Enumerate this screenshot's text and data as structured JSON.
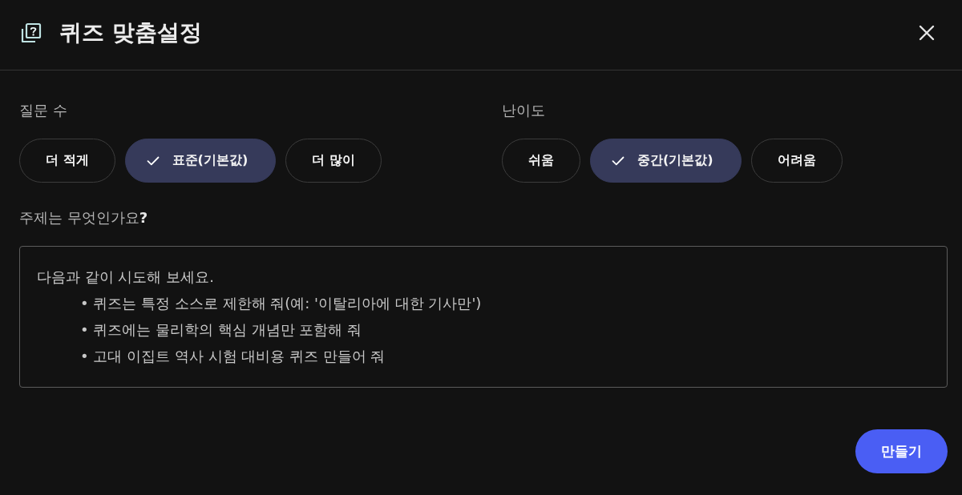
{
  "dialog": {
    "title": "퀴즈 맞춤설정"
  },
  "settings": [
    {
      "label": "질문 수",
      "options": [
        {
          "label": "더 적게",
          "selected": false
        },
        {
          "label": "표준(기본값)",
          "selected": true
        },
        {
          "label": "더 많이",
          "selected": false
        }
      ]
    },
    {
      "label": "난이도",
      "options": [
        {
          "label": "쉬움",
          "selected": false
        },
        {
          "label": "중간(기본값)",
          "selected": true
        },
        {
          "label": "어려움",
          "selected": false
        }
      ]
    }
  ],
  "topic": {
    "label": "주제는 무엇인가요**?**",
    "placeholder": "다음과 같이 시도해 보세요.",
    "examples": [
      "• 퀴즈는 특정 소스로 제한해 줘(예: '이탈리아에 대한 기사만')",
      "• 퀴즈에는 물리학의 핵심 개념만 포함해 줘",
      "• 고대 이집트 역사 시험 대비용 퀴즈 만들어 줘"
    ]
  },
  "buttons": [
    {
      "label": "만들기"
    }
  ]
}
